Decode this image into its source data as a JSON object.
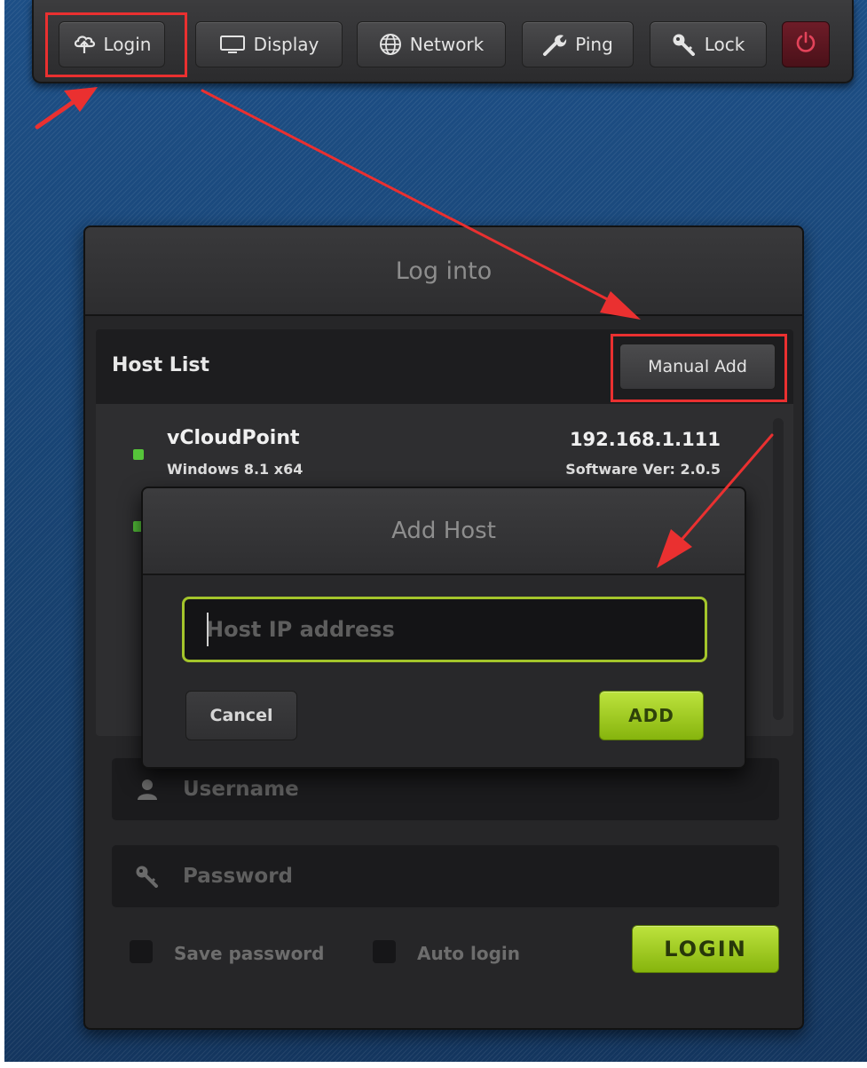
{
  "toolbar": {
    "login_label": "Login",
    "display_label": "Display",
    "network_label": "Network",
    "ping_label": "Ping",
    "lock_label": "Lock"
  },
  "login_panel": {
    "title": "Log into",
    "host_list_title": "Host List",
    "manual_add_label": "Manual Add",
    "hosts": [
      {
        "name": "vCloudPoint",
        "os": "Windows 8.1 x64",
        "ip": "192.168.1.111",
        "version": "Software Ver: 2.0.5",
        "status": "online"
      }
    ],
    "username_placeholder": "Username",
    "password_placeholder": "Password",
    "save_password_label": "Save password",
    "auto_login_label": "Auto login",
    "login_button_label": "LOGIN"
  },
  "add_host_dialog": {
    "title": "Add Host",
    "ip_placeholder": "Host IP address",
    "ip_value": "",
    "cancel_label": "Cancel",
    "add_label": "ADD"
  },
  "colors": {
    "accent_green": "#a4c52b",
    "annotation_red": "#ea3030",
    "status_online": "#56c43a",
    "power_red": "#d9344a"
  }
}
